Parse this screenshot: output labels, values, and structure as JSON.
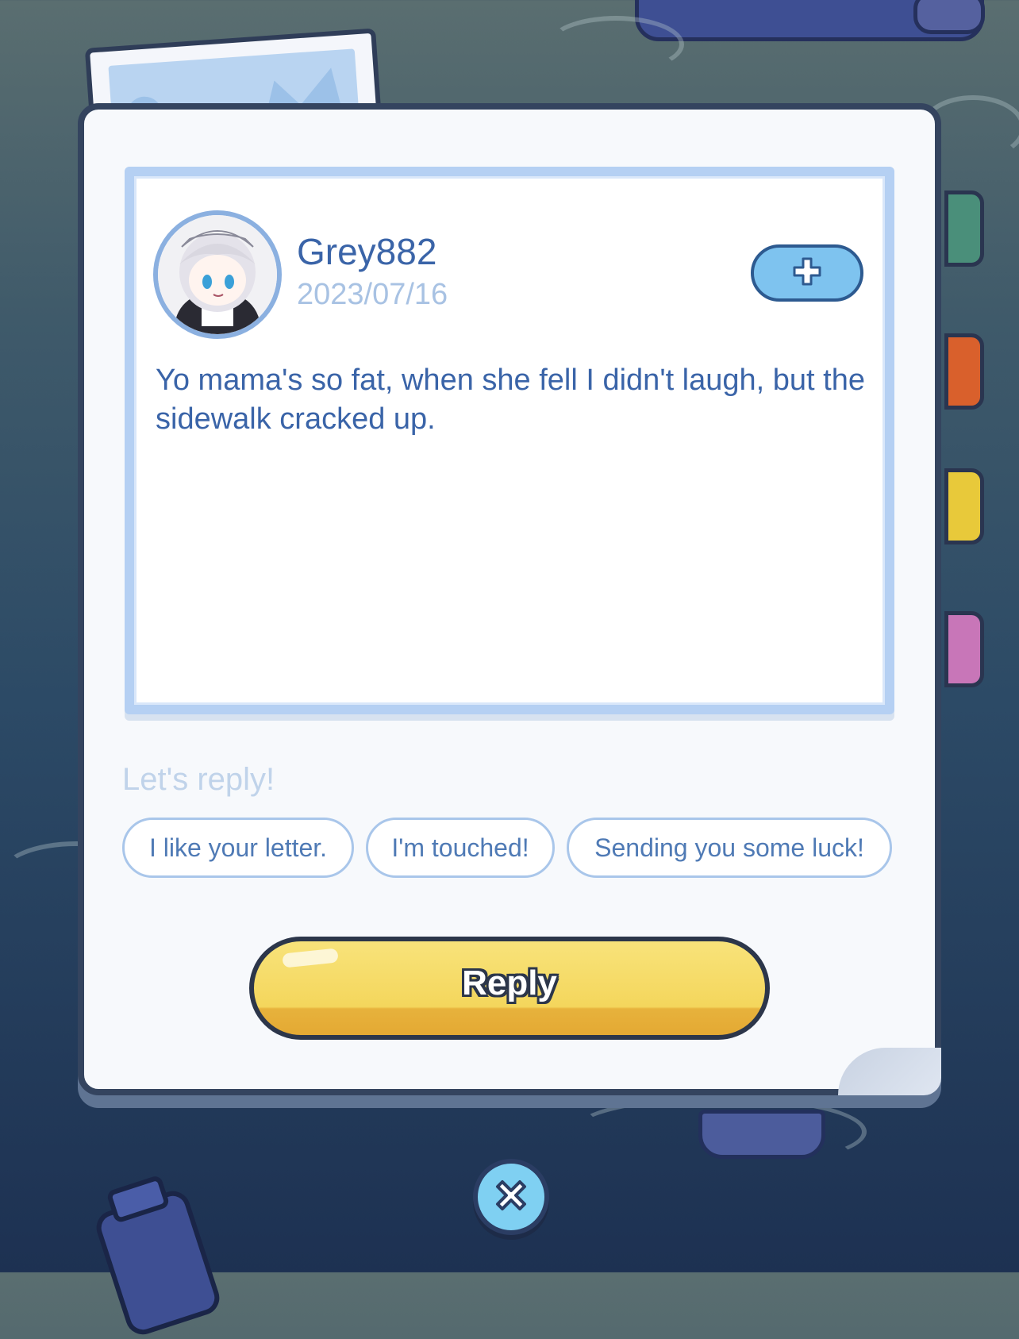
{
  "letter": {
    "username": "Grey882",
    "date": "2023/07/16",
    "message": "Yo mama's so fat, when she fell I didn't laugh, but the sidewalk cracked up.",
    "avatar_icon": "avatar-maid-girl-icon",
    "follow_icon": "plus-icon"
  },
  "reply": {
    "hint": "Let's reply!",
    "quick_replies": [
      "I like your letter.",
      "I'm touched!",
      "Sending you some luck!"
    ],
    "button_label": "Reply"
  },
  "close_icon": "close-icon",
  "colors": {
    "accent_blue": "#3a64a8",
    "reply_button_yellow": "#f4d65c",
    "close_button": "#7fd0f2"
  }
}
